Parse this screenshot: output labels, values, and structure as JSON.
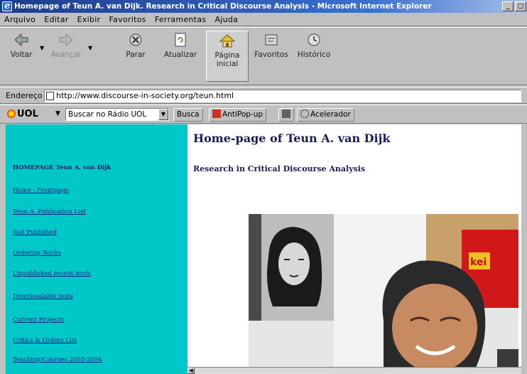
{
  "window": {
    "title": "Homepage of Teun A. van Dijk. Research in Critical Discourse Analysis - Microsoft Internet Explorer",
    "controls": [
      "_",
      "□"
    ]
  },
  "menu": [
    "Arquivo",
    "Editar",
    "Exibir",
    "Favoritos",
    "Ferramentas",
    "Ajuda"
  ],
  "toolbar": {
    "back": "Voltar",
    "forward": "Avançar",
    "stop": "Parar",
    "refresh": "Atualizar",
    "home_line1": "Página",
    "home_line2": "inicial",
    "favorites": "Favoritos",
    "history": "Histórico"
  },
  "address": {
    "label": "Endereço",
    "url": "http://www.discourse-in-society.org/teun.html"
  },
  "uol": {
    "logo": "UOL",
    "search_value": "Buscar no Rádio UOL",
    "search_button": "Busca",
    "antipopup": "AntiPop-up",
    "accelerator": "Acelerador"
  },
  "sidebar": {
    "heading": "HOMEPAGE Teun A. van Dijk",
    "links": [
      "Home - Frontpage",
      "Teun A. Publication List",
      "Just Published",
      "Ordering Books",
      "Unpublished recent work",
      "Downloadable texts",
      "Current Projects",
      "Critics & Orders List",
      "Teaching/Courses 2003-2004"
    ]
  },
  "main": {
    "title": "Home-page of Teun A. van Dijk",
    "subtitle": "Research in Critical Discourse Analysis"
  },
  "colors": {
    "sidebar_bg": "#00c8c8",
    "link": "#1a1a80",
    "titlebar": "#1c3c8c"
  }
}
